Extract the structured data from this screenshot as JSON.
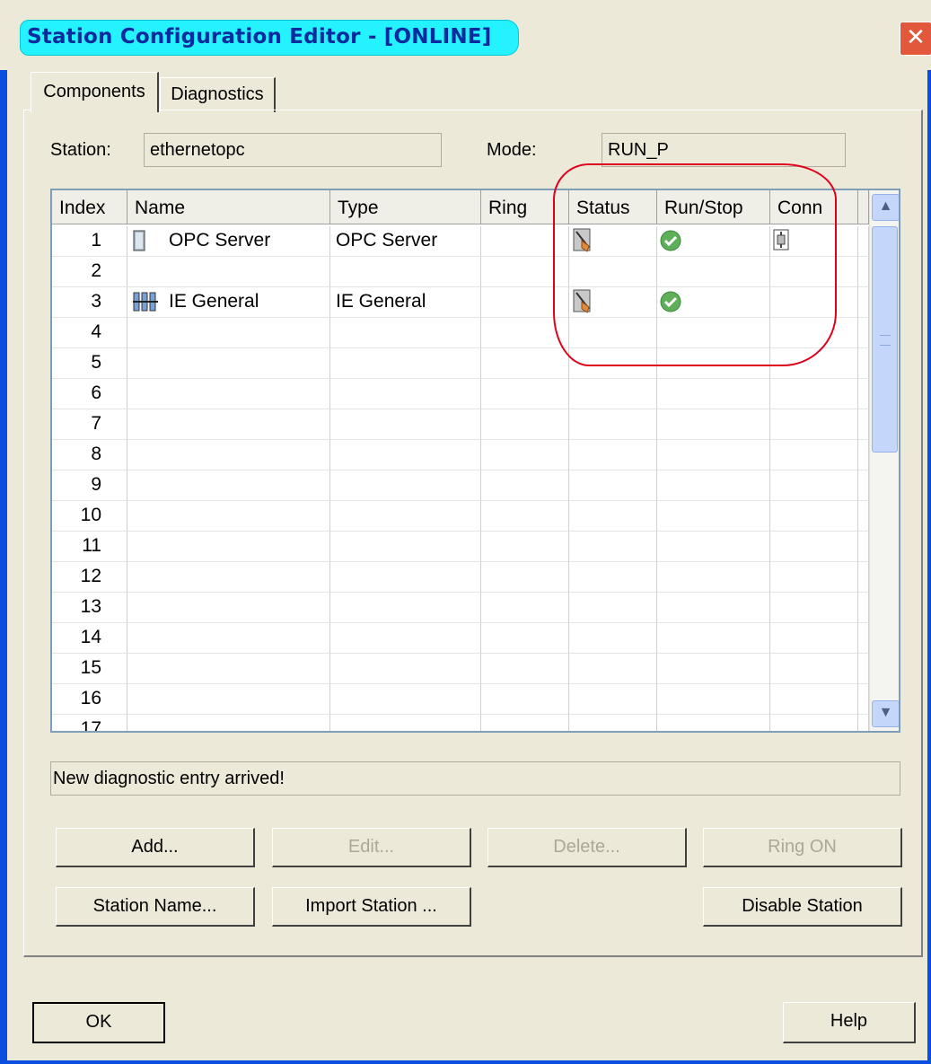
{
  "window": {
    "title": "Station Configuration Editor - [ONLINE]",
    "close_icon": "close-icon"
  },
  "tabs": [
    {
      "label": "Components",
      "active": true
    },
    {
      "label": "Diagnostics",
      "active": false
    }
  ],
  "station": {
    "label": "Station:",
    "value": "ethernetopc"
  },
  "mode": {
    "label": "Mode:",
    "value": "RUN_P"
  },
  "grid": {
    "columns": [
      "Index",
      "Name",
      "Type",
      "Ring",
      "Status",
      "Run/Stop",
      "Conn"
    ],
    "rows": [
      {
        "index": "1",
        "name": "OPC Server",
        "type": "OPC Server",
        "ring": "",
        "name_icon": "opc-server-icon",
        "status_icon": "status-icon",
        "run_icon": "run-check-icon",
        "conn_icon": "connection-icon"
      },
      {
        "index": "2",
        "name": "",
        "type": "",
        "ring": ""
      },
      {
        "index": "3",
        "name": "IE General",
        "type": "IE General",
        "ring": "",
        "name_icon": "ie-general-icon",
        "status_icon": "status-icon",
        "run_icon": "run-check-icon"
      },
      {
        "index": "4"
      },
      {
        "index": "5"
      },
      {
        "index": "6"
      },
      {
        "index": "7"
      },
      {
        "index": "8"
      },
      {
        "index": "9"
      },
      {
        "index": "10"
      },
      {
        "index": "11"
      },
      {
        "index": "12"
      },
      {
        "index": "13"
      },
      {
        "index": "14"
      },
      {
        "index": "15"
      },
      {
        "index": "16"
      },
      {
        "index": "17"
      }
    ]
  },
  "status_message": "New diagnostic entry arrived!",
  "buttons": {
    "add": "Add...",
    "edit": "Edit...",
    "delete": "Delete...",
    "ring_on": "Ring ON",
    "station_name": "Station Name...",
    "import_station": "Import Station ...",
    "disable_station": "Disable Station",
    "ok": "OK",
    "help": "Help"
  },
  "colors": {
    "title_pill": "#24f2ff",
    "window_frame": "#0a4ee0",
    "highlight": "#e0001b",
    "run_ok": "#5fae5a"
  }
}
